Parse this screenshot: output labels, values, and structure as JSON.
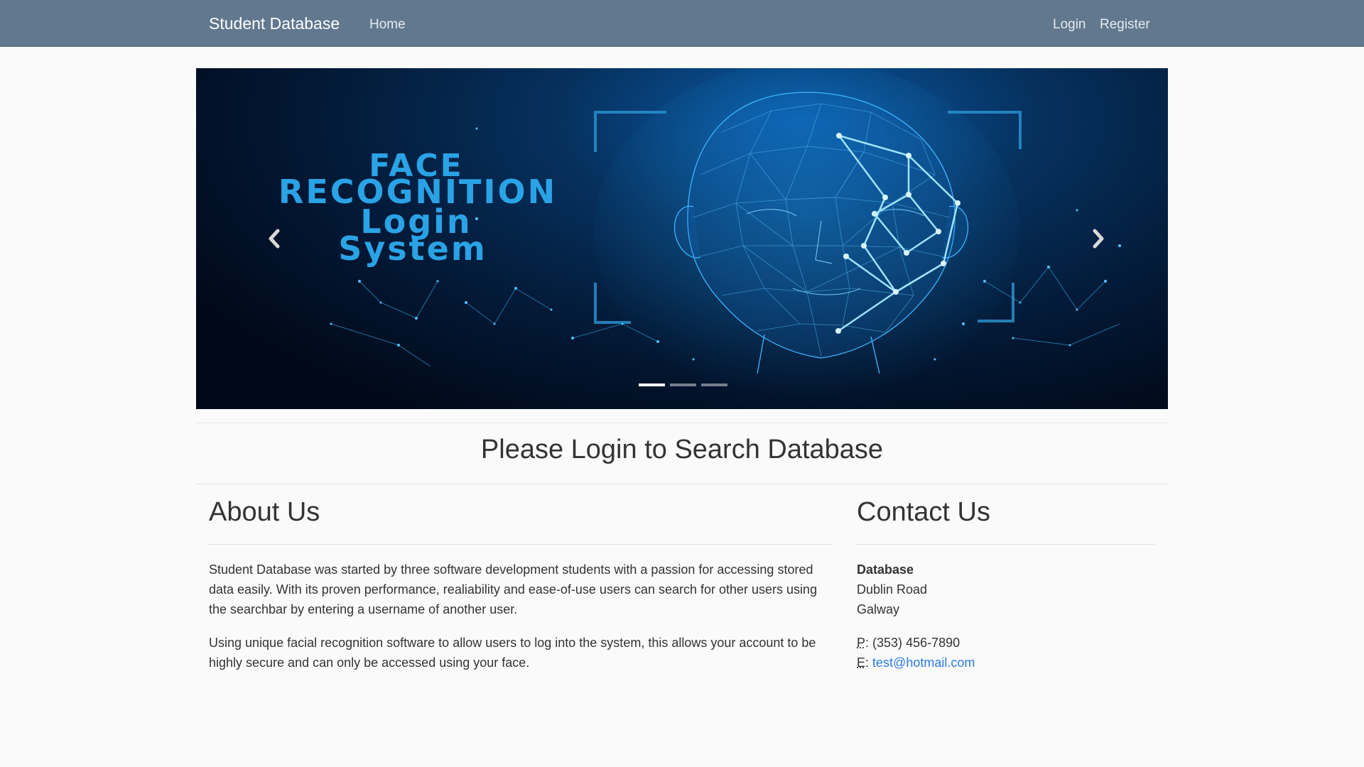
{
  "navbar": {
    "brand": "Student Database",
    "home": "Home",
    "login": "Login",
    "register": "Register",
    "background": "#61788e"
  },
  "carousel": {
    "headline_line1": "FACE",
    "headline_line2": "RECOGNITION",
    "headline_line3": "Login",
    "headline_line4": "System",
    "prev_icon": "chevron-left-icon",
    "next_icon": "chevron-right-icon",
    "slide_count": 3,
    "active_slide": 1,
    "headline_color": "#2aa3e6"
  },
  "banner": {
    "title": "Please Login to Search Database"
  },
  "about": {
    "heading": "About Us",
    "paragraph1": "Student Database was started by three software development students with a passion for accessing stored data easily. With its proven performance, realiability and ease-of-use users can search for other users using the searchbar by entering a username of another user.",
    "paragraph2": "Using unique facial recognition software to allow users to log into the system, this allows your account to be highly secure and can only be accessed using your face."
  },
  "contact": {
    "heading": "Contact Us",
    "org": "Database",
    "address_line1": "Dublin Road",
    "address_line2": "Galway",
    "phone_label": "P",
    "phone": "(353) 456-7890",
    "email_label": "E",
    "email": "test@hotmail.com",
    "link_color": "#2a7ae2"
  }
}
